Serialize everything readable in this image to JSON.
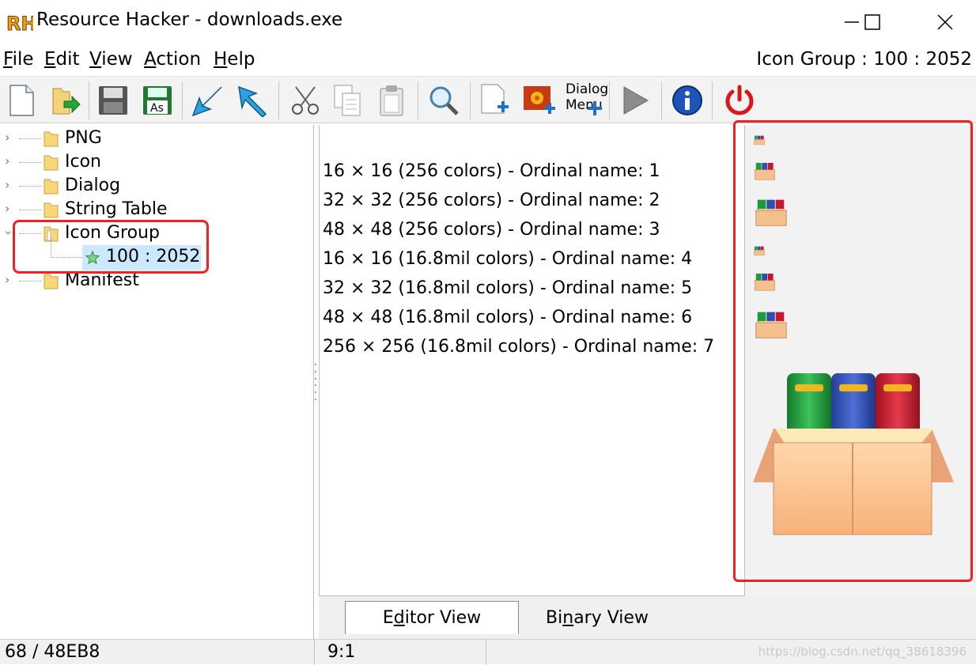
{
  "window": {
    "logo_text": "RH",
    "title": "Resource Hacker - downloads.exe",
    "minimize_icon": "minimize-icon",
    "maximize_icon": "maximize-icon",
    "close_icon": "close-icon"
  },
  "menu": {
    "items": [
      {
        "u": "F",
        "rest": "ile"
      },
      {
        "u": "E",
        "rest": "dit"
      },
      {
        "u": "V",
        "rest": "iew"
      },
      {
        "u": "A",
        "rest": "ction"
      },
      {
        "u": "H",
        "rest": "elp"
      }
    ],
    "resource_path": "Icon Group : 100 : 2052"
  },
  "toolbar": {
    "dialog_menu_label_1": "Dialog",
    "dialog_menu_label_2": "Menu",
    "save_as_label": "As"
  },
  "tree": {
    "items": [
      {
        "label": "PNG",
        "expanded": false
      },
      {
        "label": "Icon",
        "expanded": false
      },
      {
        "label": "Dialog",
        "expanded": false
      },
      {
        "label": "String Table",
        "expanded": false
      },
      {
        "label": "Icon Group",
        "expanded": true
      },
      {
        "label": "Manifest",
        "expanded": false
      }
    ],
    "child_label": "100 : 2052"
  },
  "editor": {
    "lines": [
      "16 × 16 (256 colors) - Ordinal name: 1",
      "32 × 32 (256 colors) - Ordinal name: 2",
      "48 × 48 (256 colors) - Ordinal name: 3",
      "16 × 16 (16.8mil colors) - Ordinal name: 4",
      "32 × 32 (16.8mil colors) - Ordinal name: 5",
      "48 × 48 (16.8mil colors) - Ordinal name: 6",
      "256 × 256 (16.8mil colors) - Ordinal name: 7"
    ]
  },
  "tabs": {
    "editor_view": {
      "u": "d",
      "pre": "E",
      "post": "itor View"
    },
    "binary_view": {
      "u": "n",
      "pre": "Bi",
      "post": "ary View"
    }
  },
  "status": {
    "position": "68 / 48EB8",
    "cursor": "9:1",
    "watermark": "https://blog.csdn.net/qq_38618396"
  },
  "colors": {
    "highlight": "#ee2222",
    "selection": "#cce8ff",
    "book_green": "#1f9a3a",
    "book_blue": "#2f4fb0",
    "book_red": "#c4182e",
    "box": "#f6c08e"
  }
}
